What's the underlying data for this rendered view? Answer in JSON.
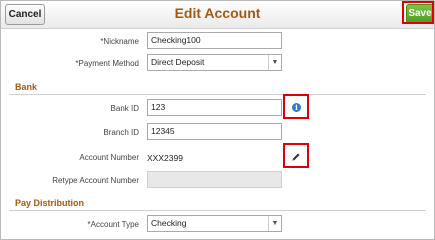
{
  "header": {
    "title": "Edit Account",
    "cancel_label": "Cancel",
    "save_label": "Save"
  },
  "top": {
    "nickname_label": "*Nickname",
    "nickname_value": "Checking100",
    "payment_method_label": "*Payment Method",
    "payment_method_value": "Direct Deposit"
  },
  "bank": {
    "section_title": "Bank",
    "bank_id_label": "Bank ID",
    "bank_id_value": "123",
    "branch_id_label": "Branch ID",
    "branch_id_value": "12345",
    "account_number_label": "Account Number",
    "account_number_value": "XXX2399",
    "retype_label": "Retype Account Number",
    "retype_value": ""
  },
  "pay_distribution": {
    "section_title": "Pay Distribution",
    "account_type_label": "*Account Type",
    "account_type_value": "Checking"
  },
  "icons": {
    "info": "info-icon",
    "edit": "pencil-icon",
    "dropdown": "chevron-down-icon"
  },
  "colors": {
    "title": "#a35a10",
    "save_button": "#5aa82c",
    "highlight": "#e00000",
    "info_icon": "#2a7bd3"
  }
}
